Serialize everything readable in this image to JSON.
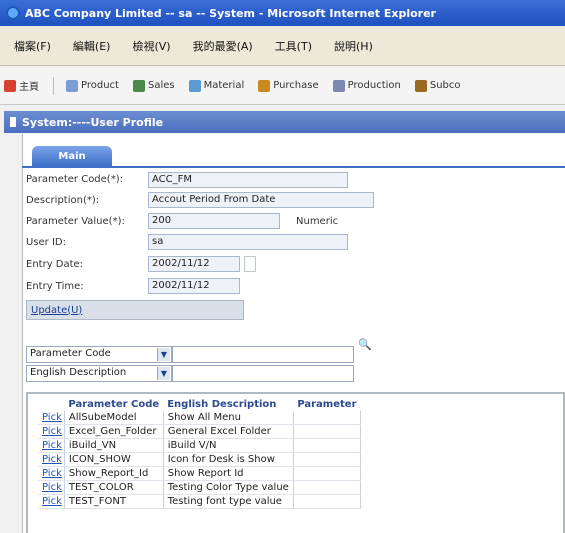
{
  "window": {
    "title": "ABC Company Limited -- sa -- System - Microsoft Internet Explorer"
  },
  "menu": [
    "檔案(F)",
    "編輯(E)",
    "檢視(V)",
    "我的最愛(A)",
    "工具(T)",
    "說明(H)"
  ],
  "apps": [
    {
      "label": "主頁",
      "color": "#d84030"
    },
    {
      "label": "Product",
      "color": "#7e9cd4"
    },
    {
      "label": "Sales",
      "color": "#4a8a4a"
    },
    {
      "label": "Material",
      "color": "#5a9ad0"
    },
    {
      "label": "Purchase",
      "color": "#c88a20"
    },
    {
      "label": "Production",
      "color": "#7a8ab0"
    },
    {
      "label": "Subco",
      "color": "#9a6a20"
    }
  ],
  "panel": {
    "title": "System:----User Profile"
  },
  "tab": {
    "label": "Main"
  },
  "form": {
    "param_code_label": "Parameter Code(*):",
    "param_code": "ACC_FM",
    "desc_label": "Description(*):",
    "desc": "Accout Period From Date",
    "param_value_label": "Parameter Value(*):",
    "param_value": "200",
    "param_type": "Numeric",
    "user_id_label": "User ID:",
    "user_id": "sa",
    "entry_date_label": "Entry Date:",
    "entry_date": "2002/11/12",
    "entry_time_label": "Entry Time:",
    "entry_time": "2002/11/12",
    "update_label": "Update(U)"
  },
  "search": {
    "field1": "Parameter Code",
    "field2": "English Description"
  },
  "table": {
    "headers": [
      "",
      "Parameter Code",
      "English Description",
      "Parameter"
    ],
    "pick_label": "Pick",
    "rows": [
      [
        "AllSubeModel",
        "Show All Menu"
      ],
      [
        "Excel_Gen_Folder",
        "General Excel Folder"
      ],
      [
        "iBuild_VN",
        "iBuild V/N"
      ],
      [
        "ICON_SHOW",
        "Icon for Desk is Show"
      ],
      [
        "Show_Report_Id",
        "Show Report Id"
      ],
      [
        "TEST_COLOR",
        "Testing Color Type value"
      ],
      [
        "TEST_FONT",
        "Testing font type value"
      ]
    ]
  }
}
